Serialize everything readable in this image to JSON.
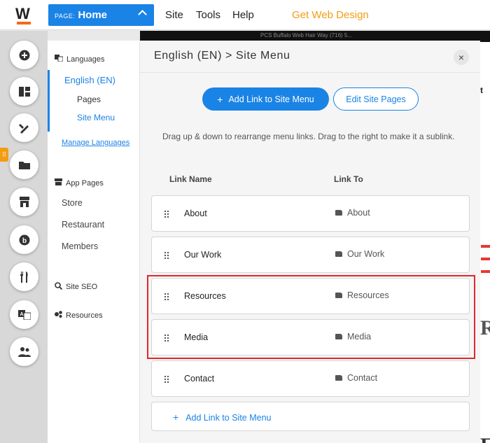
{
  "topbar": {
    "page_label": "PAGE:",
    "page_name": "Home",
    "nav": [
      "Site",
      "Tools",
      "Help"
    ],
    "get_design": "Get Web Design",
    "strip_text": "PCS Buffalo Web Hair Way (716) 5..."
  },
  "rail": {
    "icons": [
      "plus-icon",
      "layout-icon",
      "design-icon",
      "folder-icon",
      "store-icon",
      "blog-icon",
      "restaurant-icon",
      "language-icon",
      "members-icon"
    ]
  },
  "sidebar": {
    "languages_label": "Languages",
    "language_name": "English (EN)",
    "pages_label": "Pages",
    "site_menu_label": "Site Menu",
    "manage_languages": "Manage Languages",
    "app_pages_label": "App Pages",
    "app_items": [
      "Store",
      "Restaurant",
      "Members"
    ],
    "site_seo_label": "Site SEO",
    "resources_label": "Resources"
  },
  "panel": {
    "title": "English (EN) > Site Menu",
    "close": "×",
    "add_link_button": "Add Link to Site Menu",
    "edit_pages_button": "Edit Site Pages",
    "instructions": "Drag up & down to rearrange menu links. Drag to the right to make it a sublink.",
    "col_link_name": "Link Name",
    "col_link_to": "Link To",
    "rows": [
      {
        "name": "About",
        "link_to": "About"
      },
      {
        "name": "Our Work",
        "link_to": "Our Work"
      },
      {
        "name": "Resources",
        "link_to": "Resources"
      },
      {
        "name": "Media",
        "link_to": "Media"
      },
      {
        "name": "Contact",
        "link_to": "Contact"
      }
    ],
    "add_link_row": "Add Link to Site Menu"
  },
  "colors": {
    "accent": "#1a83e6",
    "highlight": "#e0262d",
    "brand_orange": "#f26b1d"
  }
}
